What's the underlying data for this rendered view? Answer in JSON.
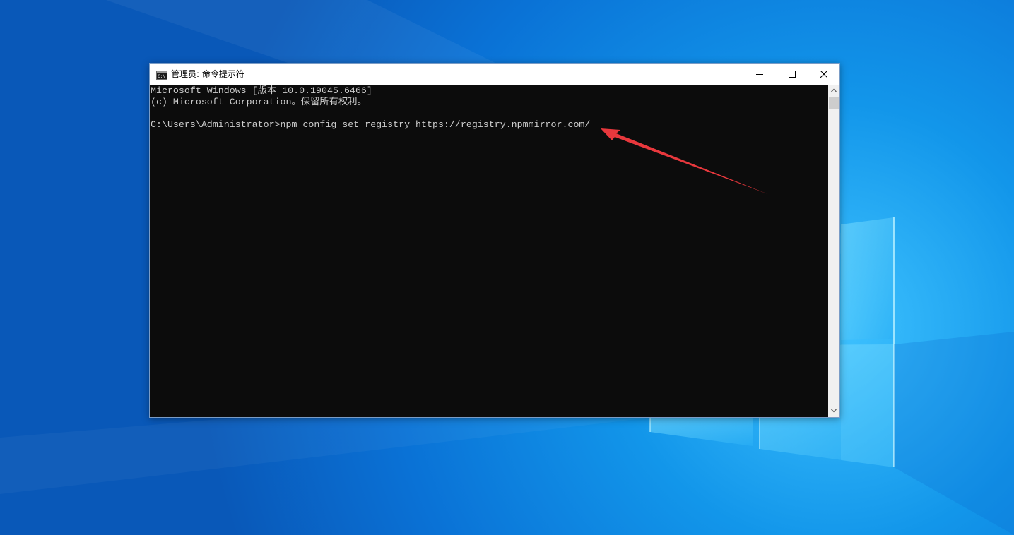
{
  "window": {
    "title": "管理员: 命令提示符",
    "icon": "cmd-icon",
    "controls": {
      "minimize_icon": "minimize-icon",
      "maximize_icon": "maximize-icon",
      "close_icon": "close-icon"
    }
  },
  "console": {
    "lines": [
      "Microsoft Windows [版本 10.0.19045.6466]",
      "(c) Microsoft Corporation。保留所有权利。",
      "",
      "C:\\Users\\Administrator>npm config set registry https://registry.npmmirror.com/"
    ]
  },
  "colors": {
    "console_background": "#0c0c0c",
    "console_text": "#cccccc",
    "annotation_arrow": "#e8383d",
    "desktop_accent": "#0a6fd4"
  },
  "annotation": {
    "type": "arrow",
    "icon": "red-arrow"
  }
}
